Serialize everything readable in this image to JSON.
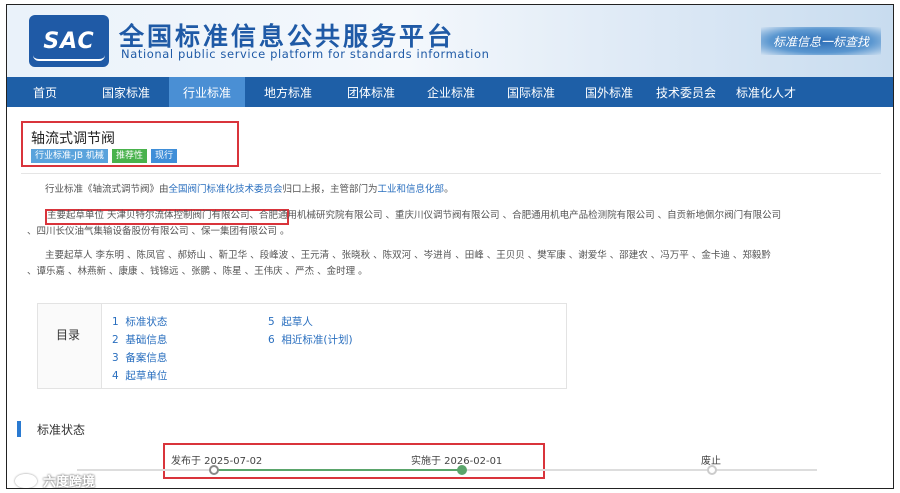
{
  "header": {
    "logo_text": "SAC",
    "title": "全国标准信息公共服务平台",
    "subtitle": "National public service platform  for standards information",
    "slogan": "标准信息一标查找"
  },
  "nav": {
    "items": [
      {
        "label": "首页"
      },
      {
        "label": "国家标准"
      },
      {
        "label": "行业标准"
      },
      {
        "label": "地方标准"
      },
      {
        "label": "团体标准"
      },
      {
        "label": "企业标准"
      },
      {
        "label": "国际标准"
      },
      {
        "label": "国外标准"
      },
      {
        "label": "技术委员会"
      },
      {
        "label": "标准化人才"
      }
    ],
    "active_index": 2
  },
  "standard": {
    "title": "轴流式调节阀",
    "tags": [
      "行业标准-JB 机械",
      "推荐性",
      "现行"
    ]
  },
  "intro": {
    "prefix": "行业标准《轴流式调节阀》由",
    "committee": "全国阀门标准化技术委员会",
    "middle": "归口上报，主管部门为",
    "dept": "工业和信息化部",
    "suffix": "。"
  },
  "drafting_units": {
    "label_first": "主要起草单位 天津贝特尔流体控制阀门有限公司",
    "rest_line1": "、合肥通用机械研究院有限公司 、重庆川仪调节阀有限公司 、合肥通用机电产品检测院有限公司 、自贡新地佩尔阀门有限公司",
    "rest_line2": "、四川长仪油气集输设备股份有限公司 、保一集团有限公司 。"
  },
  "drafters": {
    "line1": "主要起草人 李东明 、陈凤官 、郝娇山 、靳卫华 、段峰波 、王元清 、张晓秋 、陈双河 、岑进肖 、田峰 、王贝贝 、樊军康 、谢爱华 、邵建农 、冯万平 、金卡迪 、郑毅黔",
    "line2": "、谭乐嘉 、林燕新 、康康 、钱锦远 、张鹏 、陈星 、王伟庆 、严杰 、金时理 。"
  },
  "toc": {
    "label": "目录",
    "items": [
      {
        "num": "1",
        "label": "标准状态"
      },
      {
        "num": "2",
        "label": "基础信息"
      },
      {
        "num": "3",
        "label": "备案信息"
      },
      {
        "num": "4",
        "label": "起草单位"
      },
      {
        "num": "5",
        "label": "起草人"
      },
      {
        "num": "6",
        "label": "相近标准(计划)"
      }
    ]
  },
  "status": {
    "heading": "标准状态",
    "published": "发布于 2025-07-02",
    "implemented": "实施于 2026-02-01",
    "abolished": "废止"
  },
  "watermark": {
    "text": "六度跨境"
  },
  "colors": {
    "brand_blue": "#1e5fa7",
    "active_tab": "#4a8fd4",
    "highlight_red": "#d9343b",
    "timeline_green": "#5aa56b"
  }
}
